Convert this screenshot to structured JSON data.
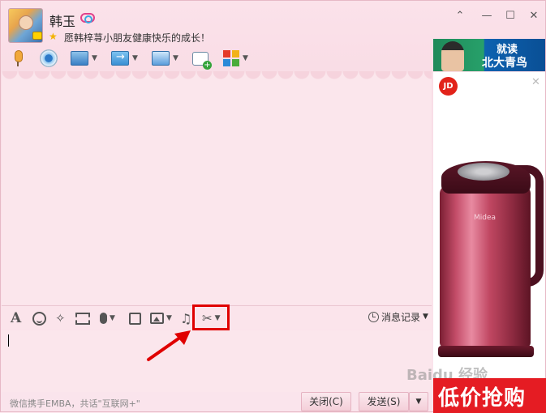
{
  "header": {
    "contact_name": "韩玉",
    "signature": "愿韩梓荨小朋友健康快乐的成长！"
  },
  "window_controls": {
    "skin": "⌃",
    "minimize": "—",
    "maximize": "☐",
    "close": "✕"
  },
  "top_toolbar": {
    "items": [
      "voice-call",
      "video-call",
      "screen-share",
      "send-file",
      "remote-assist",
      "send-sms",
      "apps"
    ]
  },
  "input_toolbar": {
    "font_label": "A",
    "shake_glyph": "✧",
    "music_glyph": "♫",
    "scissors_glyph": "✂",
    "history_label": "消息记录"
  },
  "bottom_bar": {
    "promo_text": "微信携手EMBA，共话\"互联网+\"",
    "close_label": "关闭(C)",
    "send_label": "发送(S)"
  },
  "ad": {
    "banner_line1": "就读",
    "banner_line2": "北大青鸟",
    "jd_logo": "JD",
    "product_brand": "Midea",
    "close_glyph": "✕",
    "footer_text": "低价抢购"
  },
  "watermark": "Baidu 经验",
  "colors": {
    "highlight": "#e00000",
    "ad_footer": "#e51c23"
  }
}
